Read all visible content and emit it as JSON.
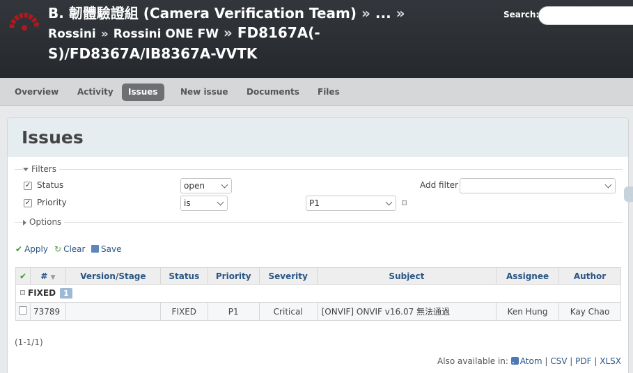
{
  "header": {
    "title_line1": "B. 韌體驗證組 (Camera Verification Team)",
    "sep": "»",
    "ellipsis": "...",
    "crumb1": "Rossini",
    "crumb2": "Rossini ONE FW",
    "title_line3a": "FD8167A(-",
    "title_line3b": "S)/FD8367A/IB8367A-VVTK",
    "search_label": "Search:",
    "search_value": ""
  },
  "menu": {
    "items": [
      {
        "label": "Overview"
      },
      {
        "label": "Activity"
      },
      {
        "label": "Issues"
      },
      {
        "label": "New issue"
      },
      {
        "label": "Documents"
      },
      {
        "label": "Files"
      }
    ],
    "selected": "Issues"
  },
  "page": {
    "title": "Issues"
  },
  "filters": {
    "legend": "Filters",
    "status_label": "Status",
    "status_op": "open",
    "priority_label": "Priority",
    "priority_op": "is",
    "priority_value": "P1",
    "add_filter_label": "Add filter",
    "add_filter_value": ""
  },
  "options": {
    "legend": "Options"
  },
  "actions": {
    "apply": "Apply",
    "clear": "Clear",
    "save": "Save"
  },
  "table": {
    "columns": [
      "#",
      "Version/Stage",
      "Status",
      "Priority",
      "Severity",
      "Subject",
      "Assignee",
      "Author"
    ],
    "group": {
      "name": "FIXED",
      "count": "1"
    },
    "rows": [
      {
        "id": "73789",
        "version": "",
        "status": "FIXED",
        "priority": "P1",
        "severity": "Critical",
        "subject": "[ONVIF] ONVIF v16.07 無法通過",
        "assignee": "Ken Hung",
        "author": "Kay Chao"
      }
    ]
  },
  "pagination": "(1-1/1)",
  "formats": {
    "label": "Also available in:",
    "atom": "Atom",
    "csv": "CSV",
    "pdf": "PDF",
    "xlsx": "XLSX",
    "sep": "|"
  },
  "colors": {
    "header_bg": "#2c2f33",
    "link": "#2a5685",
    "selected_tab": "#6d6f72",
    "badge": "#9db9d5"
  }
}
